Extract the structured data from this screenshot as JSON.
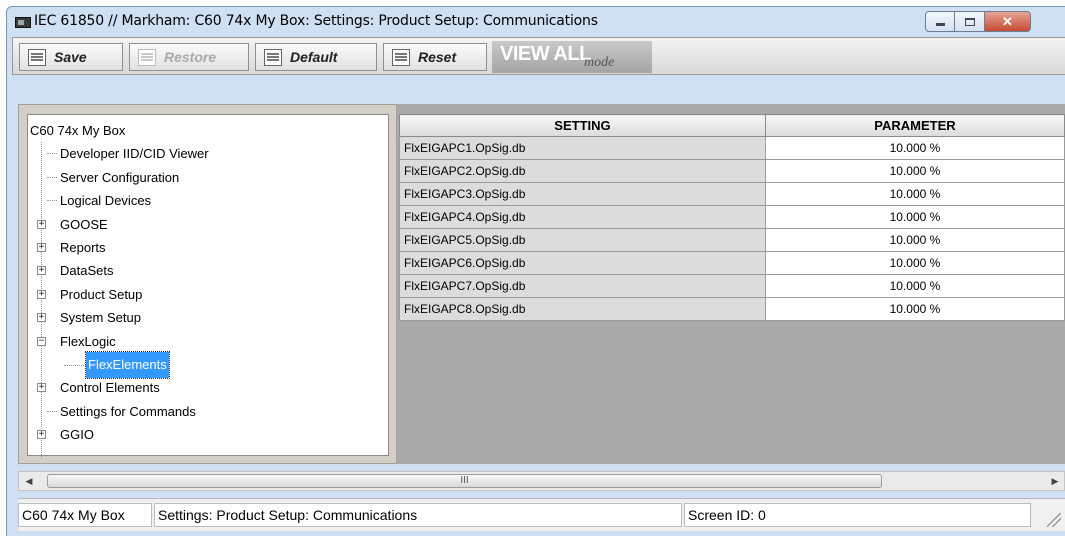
{
  "window": {
    "title": "IEC 61850 // Markham: C60 74x My Box: Settings: Product Setup: Communications",
    "controls": {
      "minimize": "–",
      "maximize": "□",
      "close": "✕"
    }
  },
  "toolbar": {
    "save_label": "Save",
    "restore_label": "Restore",
    "default_label": "Default",
    "reset_label": "Reset",
    "view_all_label": "VIEW ALL",
    "view_all_mode": "mode"
  },
  "tree": {
    "root": "C60 74x My Box",
    "items": [
      {
        "label": "Developer IID/CID Viewer",
        "expandable": false
      },
      {
        "label": "Server Configuration",
        "expandable": false
      },
      {
        "label": "Logical Devices",
        "expandable": false
      },
      {
        "label": "GOOSE",
        "expandable": true,
        "sign": "+"
      },
      {
        "label": "Reports",
        "expandable": true,
        "sign": "+"
      },
      {
        "label": "DataSets",
        "expandable": true,
        "sign": "+"
      },
      {
        "label": "Product Setup",
        "expandable": true,
        "sign": "+"
      },
      {
        "label": "System Setup",
        "expandable": true,
        "sign": "+"
      },
      {
        "label": "FlexLogic",
        "expandable": true,
        "sign": "−"
      },
      {
        "label": "Control Elements",
        "expandable": true,
        "sign": "+"
      },
      {
        "label": "Settings for Commands",
        "expandable": false
      },
      {
        "label": "GGIO",
        "expandable": true,
        "sign": "+"
      }
    ],
    "selected_child": "FlexElements"
  },
  "grid": {
    "headers": {
      "setting": "SETTING",
      "parameter": "PARAMETER"
    },
    "rows": [
      {
        "setting": "FlxEIGAPC1.OpSig.db",
        "parameter": "10.000 %"
      },
      {
        "setting": "FlxEIGAPC2.OpSig.db",
        "parameter": "10.000 %"
      },
      {
        "setting": "FlxEIGAPC3.OpSig.db",
        "parameter": "10.000 %"
      },
      {
        "setting": "FlxEIGAPC4.OpSig.db",
        "parameter": "10.000 %"
      },
      {
        "setting": "FlxEIGAPC5.OpSig.db",
        "parameter": "10.000 %"
      },
      {
        "setting": "FlxEIGAPC6.OpSig.db",
        "parameter": "10.000 %"
      },
      {
        "setting": "FlxEIGAPC7.OpSig.db",
        "parameter": "10.000 %"
      },
      {
        "setting": "FlxEIGAPC8.OpSig.db",
        "parameter": "10.000 %"
      }
    ]
  },
  "scrollbar": {
    "left_arrow": "◀",
    "right_arrow": "▶",
    "thumb_grip": "III"
  },
  "status": {
    "device": "C60 74x My Box",
    "path": "Settings: Product Setup: Communications",
    "screen_id": "Screen ID: 0"
  }
}
